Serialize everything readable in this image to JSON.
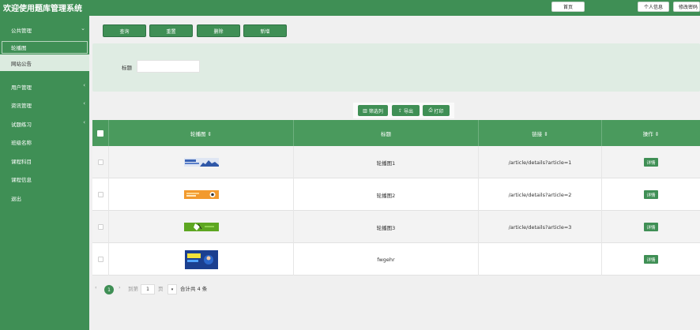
{
  "header": {
    "title": "欢迎使用题库管理系统",
    "home_label": "首页",
    "profile_label": "个人信息",
    "change_password_label": "修改密码"
  },
  "sidebar": {
    "groups": [
      {
        "label": "公共管理",
        "chevron": "⌄"
      },
      {
        "label": "用户管理",
        "chevron": "‹"
      },
      {
        "label": "资讯管理",
        "chevron": "‹"
      },
      {
        "label": "试题练习",
        "chevron": "‹"
      },
      {
        "label": "班级名称"
      },
      {
        "label": "课程科目"
      },
      {
        "label": "课程信息"
      },
      {
        "label": "退出"
      }
    ],
    "active_sub": "轮播图",
    "sub_item": "网站公告"
  },
  "toolbar": {
    "query_label": "查询",
    "reset_label": "重置",
    "delete_label": "删除",
    "add_label": "新增"
  },
  "search": {
    "title_label": "标题",
    "title_value": ""
  },
  "actions": {
    "filter_label": "筛选列",
    "export_label": "导出",
    "print_label": "打印"
  },
  "table": {
    "columns": [
      "轮播图 ⇕",
      "标题",
      "链接 ⇕",
      "操作 ⇕"
    ],
    "rows": [
      {
        "title": "轮播图1",
        "link": "/article/details?article=1",
        "action": "详情",
        "thumb": "banner-blue"
      },
      {
        "title": "轮播图2",
        "link": "/article/details?article=2",
        "action": "详情",
        "thumb": "banner-orange"
      },
      {
        "title": "轮播图3",
        "link": "/article/details?article=3",
        "action": "详情",
        "thumb": "banner-green"
      },
      {
        "title": "fwgehr",
        "link": "",
        "action": "详情",
        "thumb": "banner-dark"
      }
    ]
  },
  "pagination": {
    "prev": "‹",
    "next": "›",
    "current_page": "1",
    "goto_label": "到第",
    "goto_value": "1",
    "page_unit": "页",
    "size_arrow": "▾",
    "total_label": "合计共 4 条"
  },
  "colors": {
    "primary": "#3f8f55",
    "table_header": "#4a9a5d",
    "panel": "#dfece3"
  }
}
